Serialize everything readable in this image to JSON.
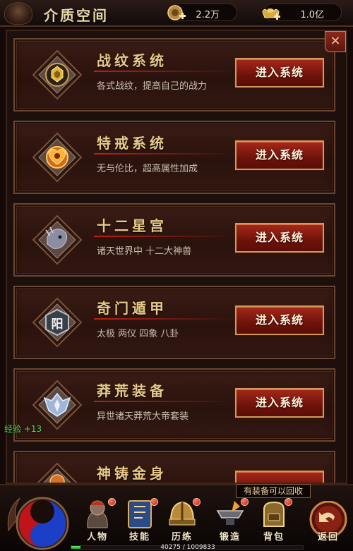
{
  "header": {
    "title": "介质空间",
    "currencies": [
      {
        "icon": "gold-coin-icon",
        "value": "2.2万"
      },
      {
        "icon": "ingot-icon",
        "value": "1.0亿"
      }
    ]
  },
  "panel": {
    "close_label": "×",
    "cards": [
      {
        "title": "战纹系统",
        "desc": "各式战纹，提高自己的战力",
        "button": "进入系统",
        "icon": "battle-pattern-icon"
      },
      {
        "title": "特戒系统",
        "desc": "无与伦比，超高属性加成",
        "button": "进入系统",
        "icon": "special-ring-icon"
      },
      {
        "title": "十二星宫",
        "desc": "诸天世界中 十二大神兽",
        "button": "进入系统",
        "icon": "beast-head-icon"
      },
      {
        "title": "奇门遁甲",
        "desc": "太极 两仪 四象 八卦",
        "button": "进入系统",
        "icon": "yang-seal-icon"
      },
      {
        "title": "莽荒装备",
        "desc": "异世诸天莽荒大帝套装",
        "button": "进入系统",
        "icon": "armor-wings-icon"
      },
      {
        "title": "神铸金身",
        "desc": "",
        "button": "",
        "icon": "golden-body-icon"
      }
    ],
    "yang_glyph": "阳"
  },
  "float": {
    "exp_gain": "经验 +13",
    "tooltip": "有装备可以回收"
  },
  "bottom_nav": {
    "items": [
      {
        "label": "人物",
        "icon": "character-icon",
        "badge": true
      },
      {
        "label": "技能",
        "icon": "skill-book-icon",
        "badge": true
      },
      {
        "label": "历练",
        "icon": "training-helmet-icon",
        "badge": true
      },
      {
        "label": "锻造",
        "icon": "anvil-forge-icon",
        "badge": true
      },
      {
        "label": "背包",
        "icon": "backpack-icon",
        "badge": true
      }
    ],
    "back_label": "返回",
    "exp_bar": {
      "current": 40275,
      "max": 1009833,
      "text": "40275 / 1009833"
    }
  },
  "colors": {
    "accent_gold": "#e8c98a",
    "button_red": "#a5281a",
    "exp_green": "#4ee04e"
  }
}
